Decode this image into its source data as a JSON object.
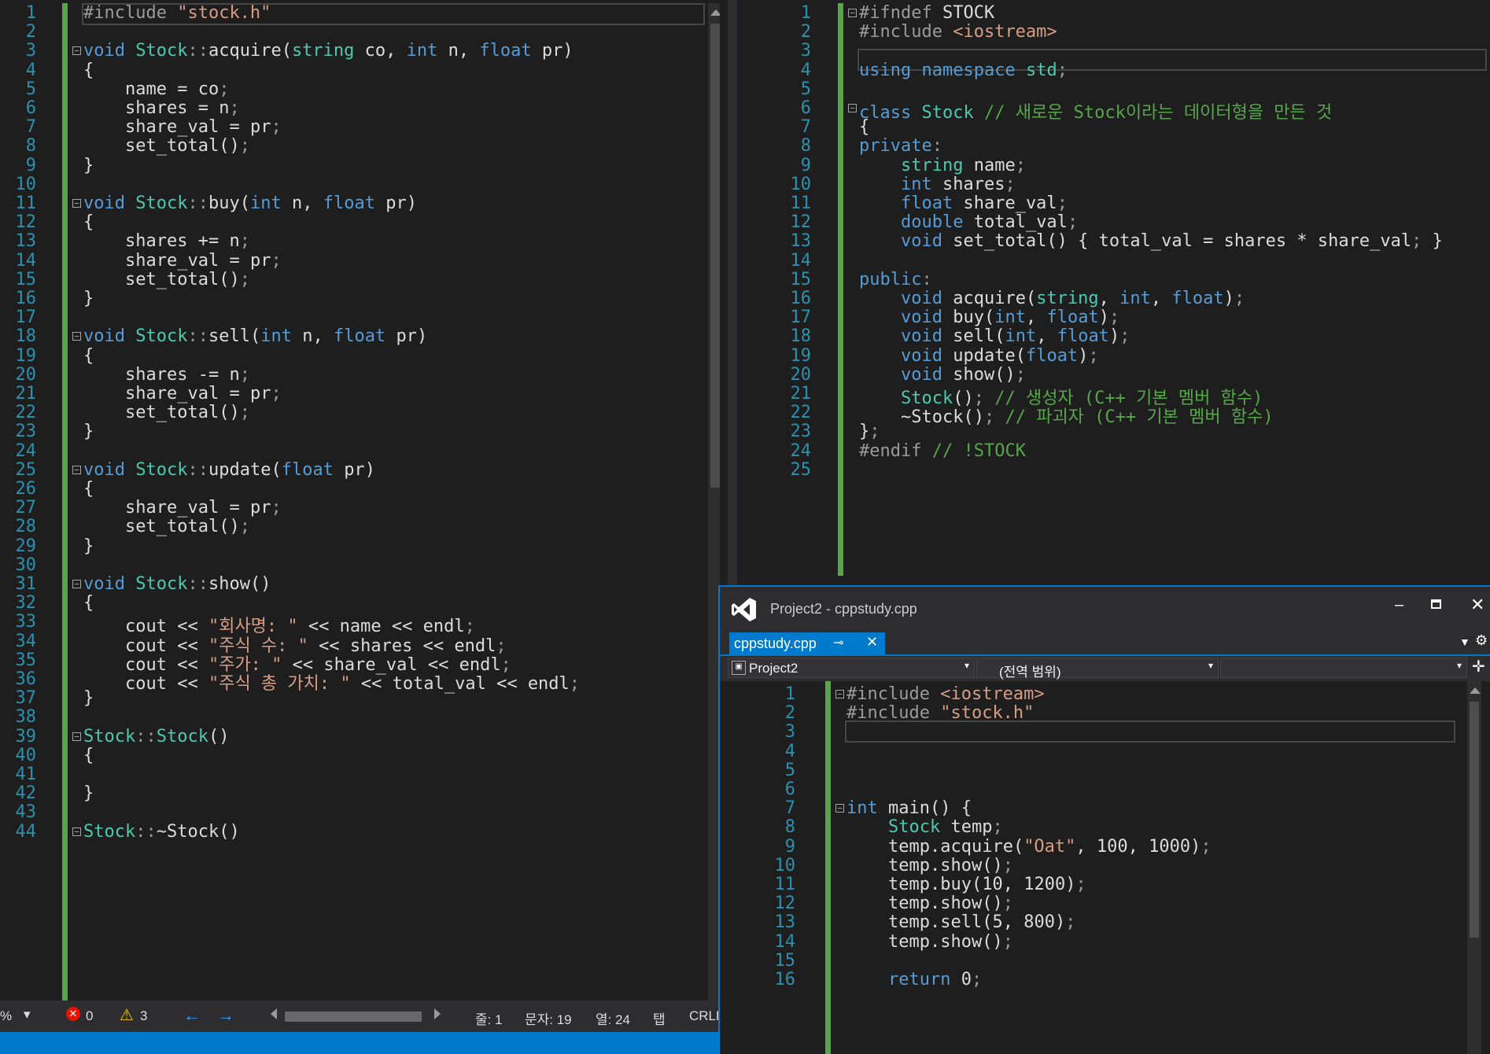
{
  "left_editor": {
    "line_numbers": [
      "1",
      "2",
      "3",
      "4",
      "5",
      "6",
      "7",
      "8",
      "9",
      "10",
      "11",
      "12",
      "13",
      "14",
      "15",
      "16",
      "17",
      "18",
      "19",
      "20",
      "21",
      "22",
      "23",
      "24",
      "25",
      "26",
      "27",
      "28",
      "29",
      "30",
      "31",
      "32",
      "33",
      "34",
      "35",
      "36",
      "37",
      "38",
      "39",
      "40",
      "41",
      "42",
      "43",
      "44"
    ],
    "lines": [
      "#include \"stock.h\"",
      "",
      "void Stock::acquire(string co, int n, float pr)",
      "{",
      "    name = co;",
      "    shares = n;",
      "    share_val = pr;",
      "    set_total();",
      "}",
      "",
      "void Stock::buy(int n, float pr)",
      "{",
      "    shares += n;",
      "    share_val = pr;",
      "    set_total();",
      "}",
      "",
      "void Stock::sell(int n, float pr)",
      "{",
      "    shares -= n;",
      "    share_val = pr;",
      "    set_total();",
      "}",
      "",
      "void Stock::update(float pr)",
      "{",
      "    share_val = pr;",
      "    set_total();",
      "}",
      "",
      "void Stock::show()",
      "{",
      "    cout << \"회사명: \" << name << endl;",
      "    cout << \"주식 수: \" << shares << endl;",
      "    cout << \"주가: \" << share_val << endl;",
      "    cout << \"주식 총 가치: \" << total_val << endl;",
      "}",
      "",
      "Stock::Stock()",
      "{",
      "",
      "}",
      "",
      "Stock::~Stock()"
    ]
  },
  "right_editor": {
    "line_numbers": [
      "1",
      "2",
      "3",
      "4",
      "5",
      "6",
      "7",
      "8",
      "9",
      "10",
      "11",
      "12",
      "13",
      "14",
      "15",
      "16",
      "17",
      "18",
      "19",
      "20",
      "21",
      "22",
      "23",
      "24",
      "25"
    ],
    "lines": [
      "#ifndef STOCK",
      "#include <iostream>",
      "",
      "using namespace std;",
      "",
      "class Stock // 새로운 Stock이라는 데이터형을 만든 것",
      "{",
      "private:",
      "    string name;",
      "    int shares;",
      "    float share_val;",
      "    double total_val;",
      "    void set_total() { total_val = shares * share_val; }",
      "",
      "public:",
      "    void acquire(string, int, float);",
      "    void buy(int, float);",
      "    void sell(int, float);",
      "    void update(float);",
      "    void show();",
      "    Stock(); // 생성자 (C++ 기본 멤버 함수)",
      "    ~Stock(); // 파괴자 (C++ 기본 멤버 함수)",
      "};",
      "#endif // !STOCK",
      ""
    ]
  },
  "status_bar": {
    "zoom_partial": "%",
    "errors": "0",
    "warnings": "3",
    "line": "줄: 1",
    "char": "문자: 19",
    "col": "열: 24",
    "tab": "탭",
    "eol": "CRLF"
  },
  "floating_window": {
    "title": "Project2 - cppstudy.cpp",
    "tab_label": "cppstudy.cpp",
    "nav_project": "Project2",
    "nav_scope": "(전역 범위)",
    "line_numbers": [
      "1",
      "2",
      "3",
      "4",
      "5",
      "6",
      "7",
      "8",
      "9",
      "10",
      "11",
      "12",
      "13",
      "14",
      "15",
      "16"
    ],
    "lines": [
      "#include <iostream>",
      "#include \"stock.h\"",
      "",
      "",
      "",
      "",
      "int main() {",
      "    Stock temp;",
      "    temp.acquire(\"Oat\", 100, 1000);",
      "    temp.show();",
      "    temp.buy(10, 1200);",
      "    temp.show();",
      "    temp.sell(5, 800);",
      "    temp.show();",
      "",
      "    return 0;"
    ]
  },
  "colors": {
    "keyword": "#569cd6",
    "type": "#4ec9b0",
    "string": "#d69d85",
    "comment": "#57a64a",
    "line_number": "#2b91af",
    "accent": "#007acc"
  }
}
